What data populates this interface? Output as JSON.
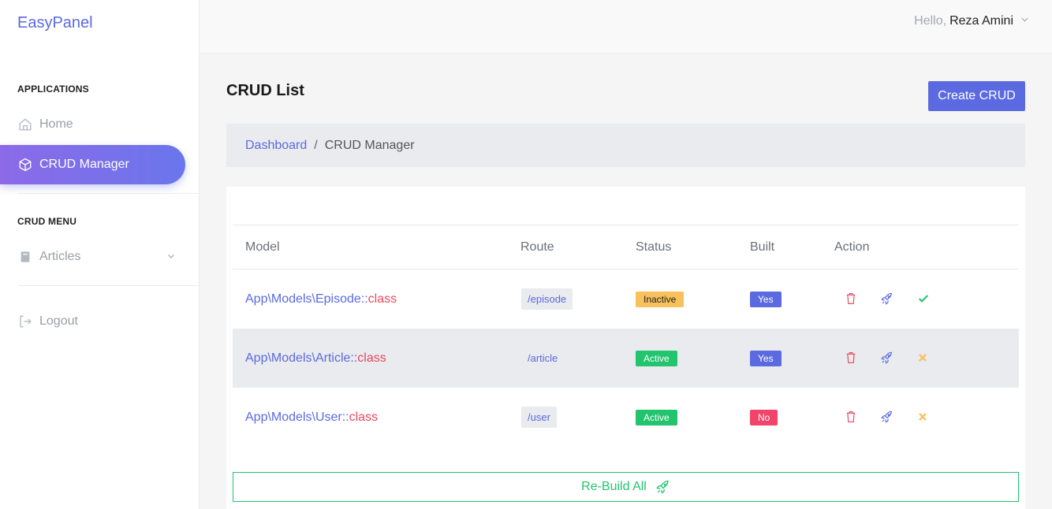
{
  "sidebar": {
    "brand": "EasyPanel",
    "sections": [
      {
        "title": "APPLICATIONS"
      },
      {
        "title": "CRUD MENU"
      }
    ],
    "items": [
      {
        "label": "Home",
        "icon": "home-icon"
      },
      {
        "label": "CRUD Manager",
        "icon": "box-icon",
        "active": true
      },
      {
        "label": "Articles",
        "icon": "book-icon"
      },
      {
        "label": "Logout",
        "icon": "logout-icon"
      }
    ]
  },
  "topbar": {
    "hello": "Hello,",
    "username": "Reza Amini"
  },
  "page": {
    "title": "CRUD List",
    "create_button": "Create CRUD"
  },
  "breadcrumb": {
    "link": "Dashboard",
    "separator": "/",
    "current": "CRUD Manager"
  },
  "table": {
    "headers": [
      "Model",
      "Route",
      "Status",
      "Built",
      "Action"
    ],
    "rows": [
      {
        "model": "App\\Models\\Episode::",
        "model_class": "class",
        "route": "/episode",
        "status": "Inactive",
        "built": "Yes",
        "action_state": "check-icon"
      },
      {
        "model": "App\\Models\\Article::",
        "model_class": "class",
        "route": "/article",
        "status": "Active",
        "built": "Yes",
        "action_state": "close-icon"
      },
      {
        "model": "App\\Models\\User::",
        "model_class": "class",
        "route": "/user",
        "status": "Active",
        "built": "No",
        "action_state": "close-icon"
      }
    ]
  },
  "rebuild_label": "Re-Build All",
  "colors": {
    "accent": "#5b6ae0",
    "success": "#22c46e",
    "danger": "#f2446a",
    "warning": "#f8c15b"
  }
}
